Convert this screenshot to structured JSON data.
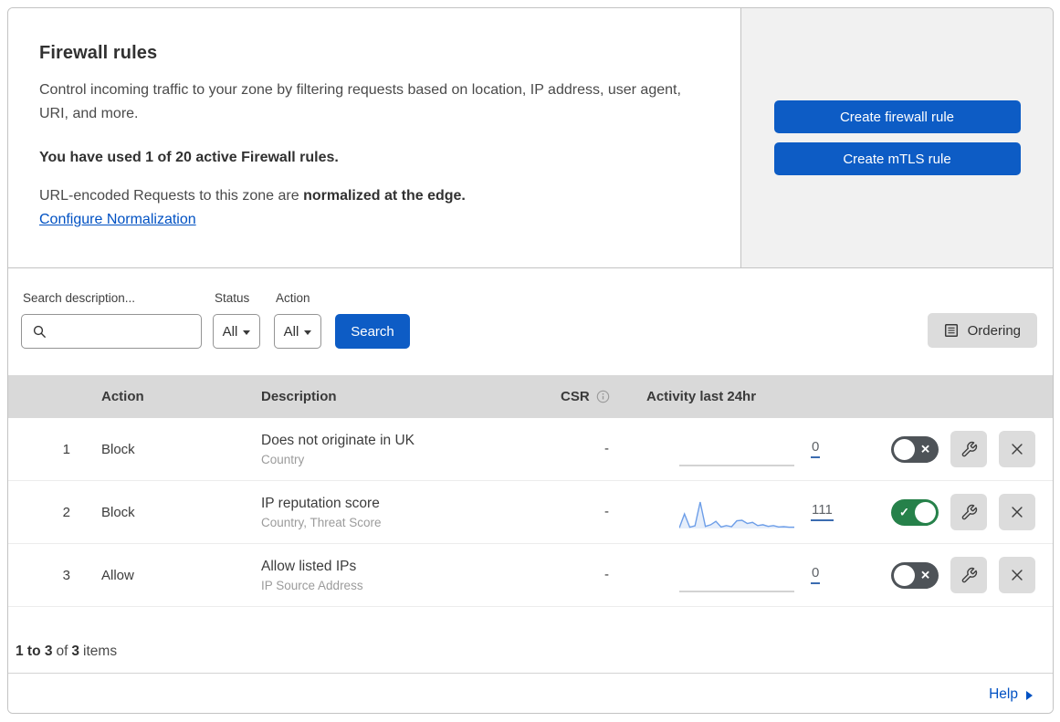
{
  "header": {
    "title": "Firewall rules",
    "description": "Control incoming traffic to your zone by filtering requests based on location, IP address, user agent, URI, and more.",
    "usage_note": "You have used 1 of 20 active Firewall rules.",
    "normalization_prefix": "URL-encoded Requests to this zone are",
    "normalization_bold": "normalized at the edge.",
    "normalization_link": "Configure Normalization",
    "create_firewall_button": "Create firewall rule",
    "create_mtls_button": "Create mTLS rule"
  },
  "filters": {
    "search_label": "Search description...",
    "status_label": "Status",
    "status_value": "All",
    "action_label": "Action",
    "action_value": "All",
    "search_button": "Search",
    "ordering_button": "Ordering"
  },
  "table": {
    "headers": {
      "action": "Action",
      "description": "Description",
      "csr": "CSR",
      "activity": "Activity last 24hr"
    },
    "rows": [
      {
        "num": "1",
        "action": "Block",
        "description": "Does not originate in UK",
        "criteria": "Country",
        "csr": "-",
        "activity_count": "0",
        "enabled": false,
        "sparkline": null
      },
      {
        "num": "2",
        "action": "Block",
        "description": "IP reputation score",
        "criteria": "Country, Threat Score",
        "csr": "-",
        "activity_count": "111",
        "enabled": true,
        "sparkline": [
          2,
          55,
          5,
          10,
          100,
          8,
          14,
          27,
          6,
          11,
          7,
          29,
          31,
          19,
          23,
          11,
          14,
          8,
          11,
          6,
          7,
          5,
          5
        ]
      },
      {
        "num": "3",
        "action": "Allow",
        "description": "Allow listed IPs",
        "criteria": "IP Source Address",
        "csr": "-",
        "activity_count": "0",
        "enabled": false,
        "sparkline": null
      }
    ]
  },
  "footer": {
    "range": "1 to 3",
    "of_label": "of",
    "total": "3",
    "items_label": "items"
  },
  "help": {
    "label": "Help"
  },
  "colors": {
    "primary_blue": "#0d5cc5",
    "link_blue": "#0051c3",
    "toggle_on_green": "#26814a",
    "toggle_off_gray": "#4e5358",
    "sparkline_blue": "#6d9ee8",
    "sparkline_fill": "#dbe7f8",
    "flat_line_gray": "#b9b9b9",
    "table_header_gray": "#d9d9d9",
    "side_panel_gray": "#f1f1f1"
  }
}
